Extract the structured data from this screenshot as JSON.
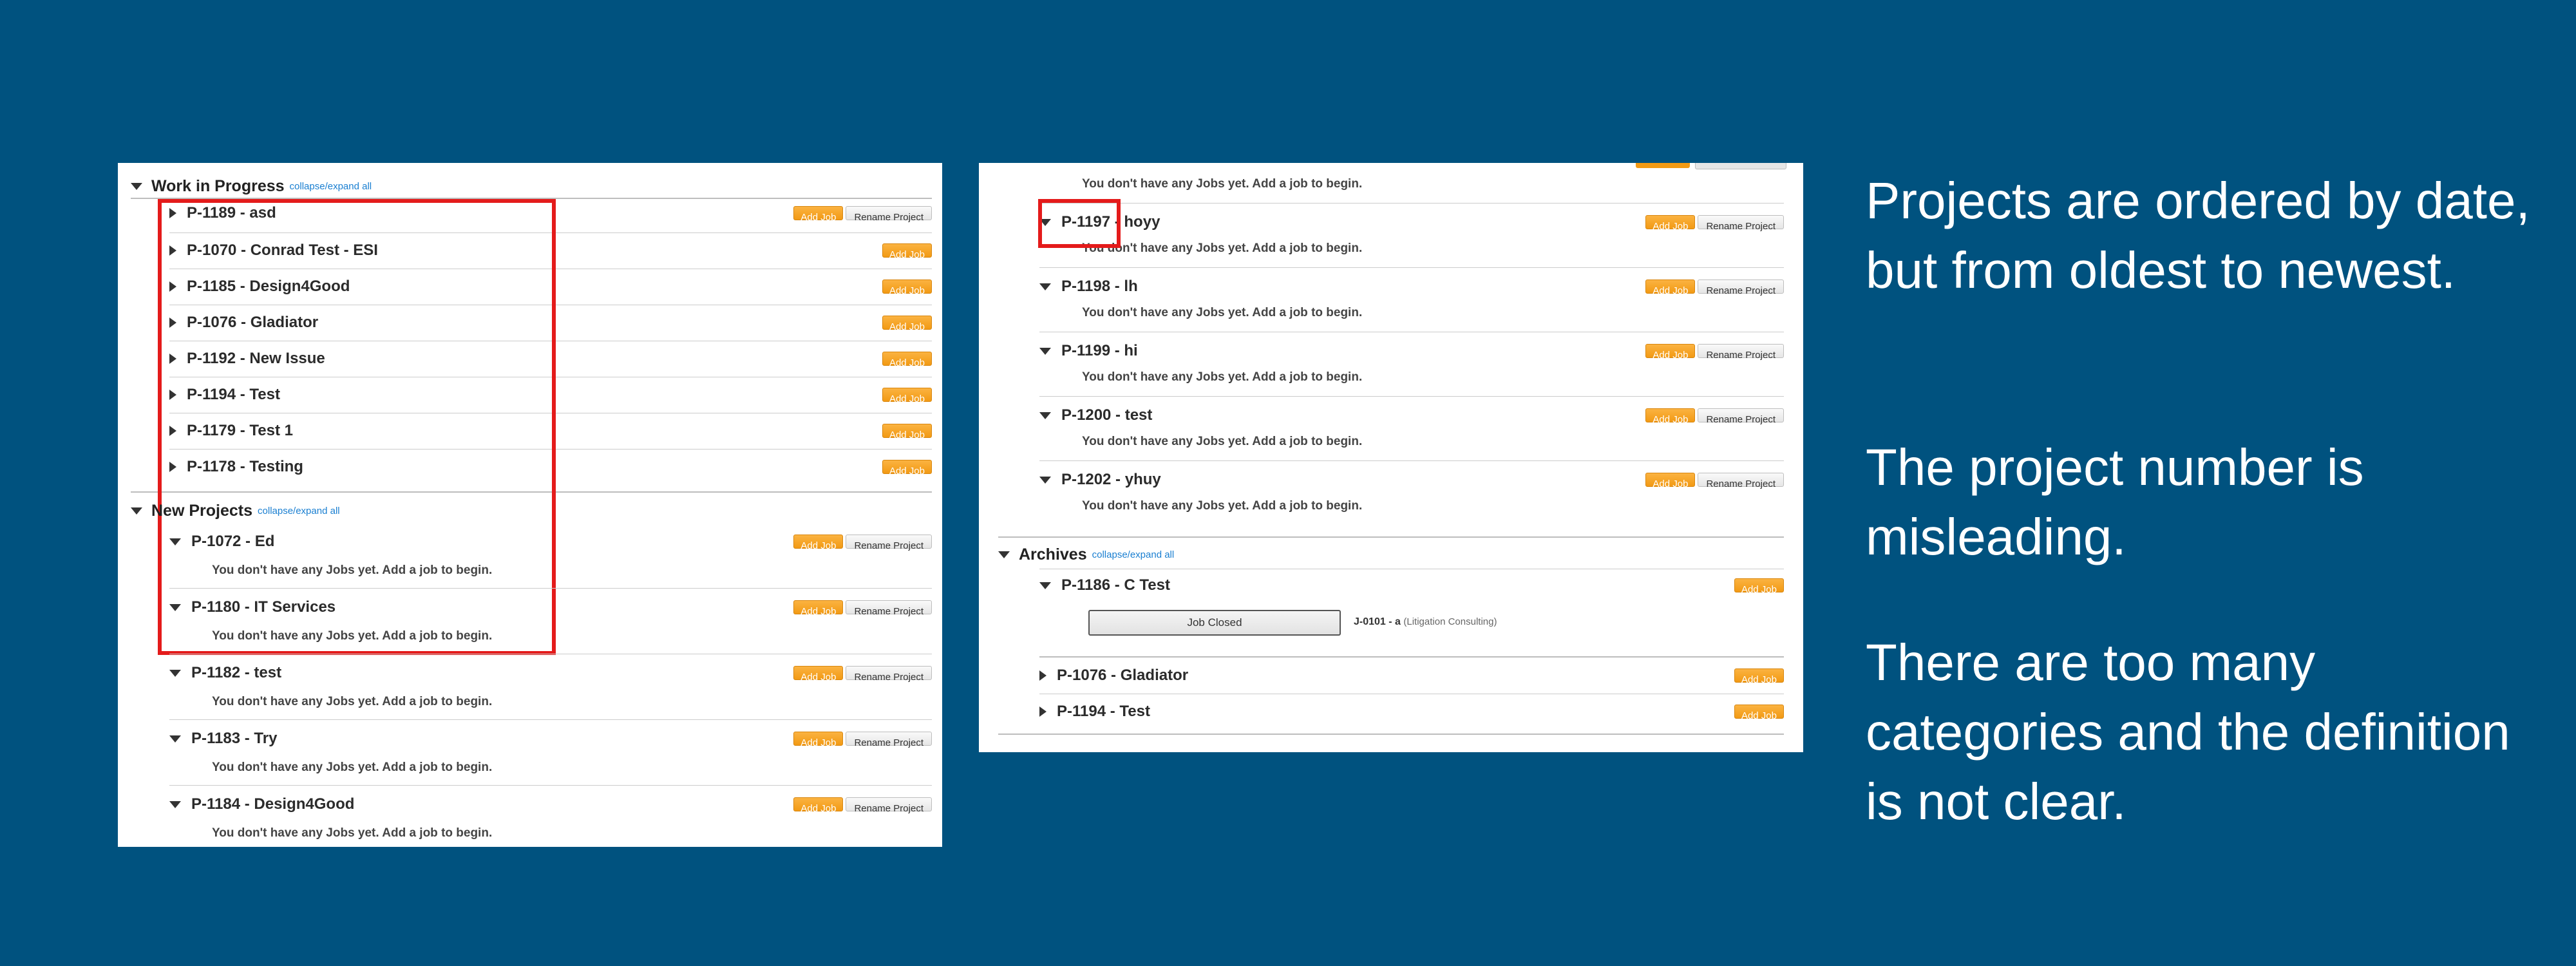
{
  "left_panel": {
    "work_in_progress": {
      "title": "Work in Progress",
      "collapse_label": "collapse/expand all",
      "projects": [
        {
          "title": "P-1189 - asd",
          "add_job": "Add Job",
          "rename": "Rename Project"
        },
        {
          "title": "P-1070 - Conrad Test - ESI",
          "add_job": "Add Job"
        },
        {
          "title": "P-1185 - Design4Good",
          "add_job": "Add Job"
        },
        {
          "title": "P-1076 - Gladiator",
          "add_job": "Add Job"
        },
        {
          "title": "P-1192 - New Issue",
          "add_job": "Add Job"
        },
        {
          "title": "P-1194 - Test",
          "add_job": "Add Job"
        },
        {
          "title": "P-1179 - Test 1",
          "add_job": "Add Job"
        },
        {
          "title": "P-1178 - Testing",
          "add_job": "Add Job"
        }
      ]
    },
    "new_projects": {
      "title": "New Projects",
      "collapse_label": "collapse/expand all",
      "projects": [
        {
          "title": "P-1072 - Ed",
          "add_job": "Add Job",
          "rename": "Rename Project",
          "message": "You don't have any Jobs yet. Add a job to begin."
        },
        {
          "title": "P-1180 - IT Services",
          "add_job": "Add Job",
          "rename": "Rename Project",
          "message": "You don't have any Jobs yet. Add a job to begin."
        },
        {
          "title": "P-1182 - test",
          "add_job": "Add Job",
          "rename": "Rename Project",
          "message": "You don't have any Jobs yet. Add a job to begin."
        },
        {
          "title": "P-1183 - Try",
          "add_job": "Add Job",
          "rename": "Rename Project",
          "message": "You don't have any Jobs yet. Add a job to begin."
        },
        {
          "title": "P-1184 - Design4Good",
          "add_job": "Add Job",
          "rename": "Rename Project",
          "message": "You don't have any Jobs yet. Add a job to begin."
        }
      ]
    }
  },
  "right_panel": {
    "top_message": "You don't have any Jobs yet. Add a job to begin.",
    "projects": [
      {
        "title": "P-1197 - hoyy",
        "add_job": "Add Job",
        "rename": "Rename Project",
        "message": "You don't have any Jobs yet. Add a job to begin."
      },
      {
        "title": "P-1198 - lh",
        "add_job": "Add Job",
        "rename": "Rename Project",
        "message": "You don't have any Jobs yet. Add a job to begin."
      },
      {
        "title": "P-1199 - hi",
        "add_job": "Add Job",
        "rename": "Rename Project",
        "message": "You don't have any Jobs yet. Add a job to begin."
      },
      {
        "title": "P-1200 - test",
        "add_job": "Add Job",
        "rename": "Rename Project",
        "message": "You don't have any Jobs yet. Add a job to begin."
      },
      {
        "title": "P-1202 - yhuy",
        "add_job": "Add Job",
        "rename": "Rename Project",
        "message": "You don't have any Jobs yet. Add a job to begin."
      }
    ],
    "archives": {
      "title": "Archives",
      "collapse_label": "collapse/expand all",
      "projects": [
        {
          "title": "P-1186 - C Test",
          "add_job": "Add Job",
          "job_button": "Job Closed",
          "job_id": "J-0101 - a",
          "job_category": "(Litigation Consulting)"
        },
        {
          "title": "P-1076 - Gladiator",
          "add_job": "Add Job"
        },
        {
          "title": "P-1194 - Test",
          "add_job": "Add Job"
        }
      ]
    }
  },
  "callouts": {
    "ordering": "Projects are ordered by date, but from oldest to newest.",
    "numbering": "The project number is misleading.",
    "categories": "There are too many categories and the definition is not clear."
  },
  "colors": {
    "background": "#00527f",
    "highlight": "#e41b1b",
    "add_button": "#f29a14",
    "link": "#1a7fd1"
  }
}
